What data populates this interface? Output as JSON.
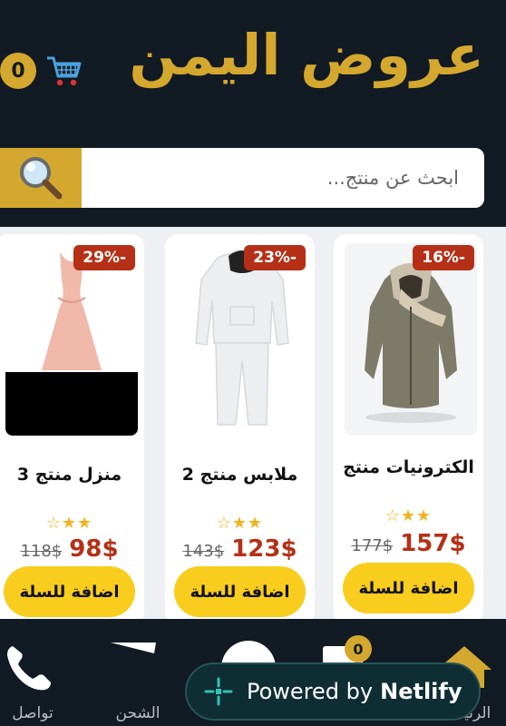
{
  "header": {
    "site_title": "عروض اليمن",
    "cart_count": "0"
  },
  "search": {
    "placeholder": "ابحث عن منتج..."
  },
  "colors": {
    "header_bg": "#121a23",
    "accent": "#d4a82e",
    "discount_bg": "#b53017",
    "button_bg": "#f8cd1d"
  },
  "products": [
    {
      "name": "الكترونيات منتج",
      "discount": "16%-",
      "rating": 3,
      "rating_text": "☆★★",
      "old_price": "177$",
      "new_price": "157$",
      "add_label": "اضافة للسلة",
      "image": "jacket"
    },
    {
      "name": "ملابس منتج 2",
      "discount": "23%-",
      "rating": 3,
      "rating_text": "☆★★",
      "old_price": "143$",
      "new_price": "123$",
      "add_label": "اضافة للسلة",
      "image": "white-tracksuit"
    },
    {
      "name": "منزل منتج 3",
      "discount": "29%-",
      "rating": 3,
      "rating_text": "☆★★",
      "old_price": "118$",
      "new_price": "98$",
      "add_label": "اضافة للسلة",
      "image": "pink-dress"
    }
  ],
  "bottom_nav": {
    "items": [
      {
        "label": "الرئيسية",
        "icon": "home-icon"
      },
      {
        "label": "",
        "icon": "cart-icon",
        "badge": "0"
      },
      {
        "label": "",
        "icon": "user-icon"
      },
      {
        "label": "الشحن",
        "icon": "truck-icon"
      },
      {
        "label": "تواصل",
        "icon": "phone-icon"
      }
    ]
  },
  "netlify_badge": {
    "prefix": "Powered by",
    "brand": "Netlify"
  }
}
